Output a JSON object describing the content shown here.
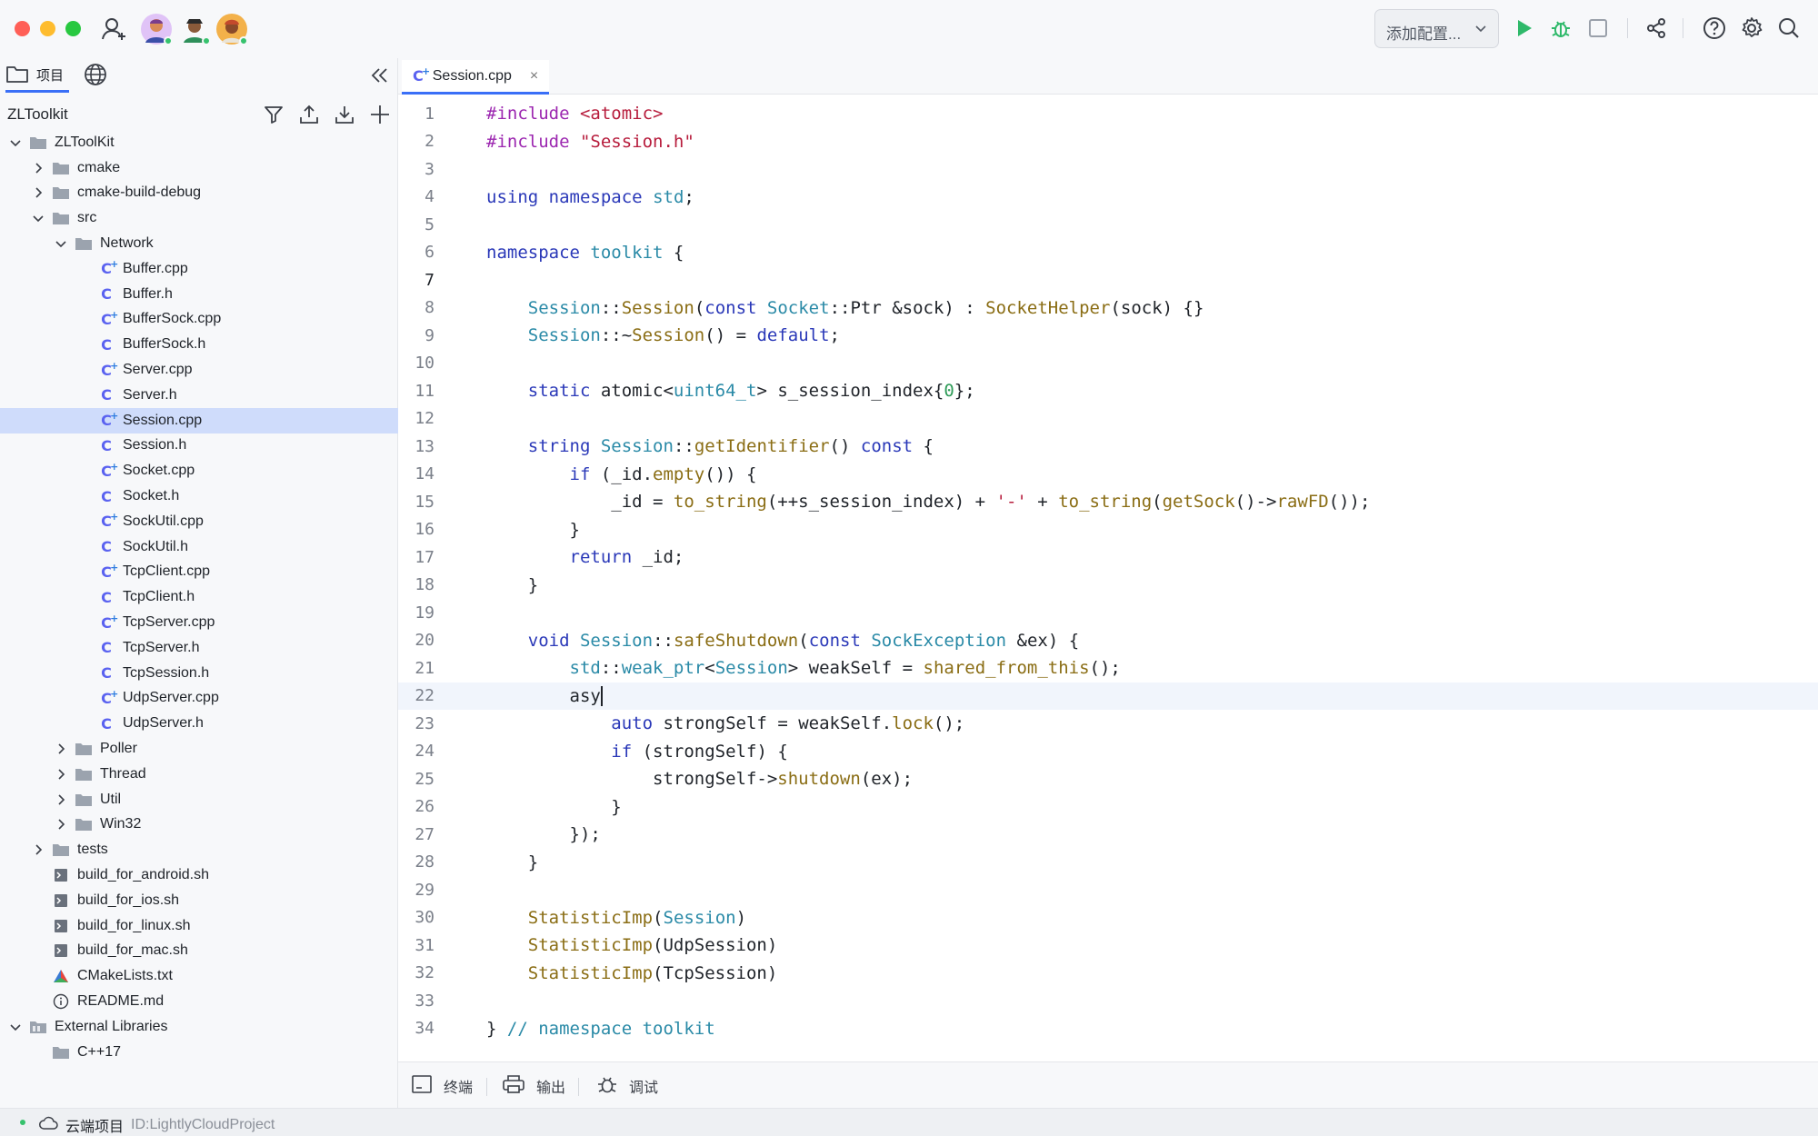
{
  "titlebar": {
    "config_label": "添加配置..."
  },
  "sidebar": {
    "tabs": [
      {
        "label": "项目",
        "icon": "folder-icon"
      },
      {
        "label": "",
        "icon": "globe-icon"
      }
    ],
    "project_name": "ZLToolkit",
    "tree": [
      {
        "label": "ZLToolKit",
        "depth": 0,
        "kind": "folder",
        "expanded": true
      },
      {
        "label": "cmake",
        "depth": 1,
        "kind": "folder",
        "expanded": false
      },
      {
        "label": "cmake-build-debug",
        "depth": 1,
        "kind": "folder",
        "expanded": false
      },
      {
        "label": "src",
        "depth": 1,
        "kind": "folder",
        "expanded": true
      },
      {
        "label": "Network",
        "depth": 2,
        "kind": "folder",
        "expanded": true
      },
      {
        "label": "Buffer.cpp",
        "depth": 3,
        "kind": "cpp"
      },
      {
        "label": "Buffer.h",
        "depth": 3,
        "kind": "h"
      },
      {
        "label": "BufferSock.cpp",
        "depth": 3,
        "kind": "cpp"
      },
      {
        "label": "BufferSock.h",
        "depth": 3,
        "kind": "h"
      },
      {
        "label": "Server.cpp",
        "depth": 3,
        "kind": "cpp"
      },
      {
        "label": "Server.h",
        "depth": 3,
        "kind": "h"
      },
      {
        "label": "Session.cpp",
        "depth": 3,
        "kind": "cpp",
        "selected": true
      },
      {
        "label": "Session.h",
        "depth": 3,
        "kind": "h"
      },
      {
        "label": "Socket.cpp",
        "depth": 3,
        "kind": "cpp"
      },
      {
        "label": "Socket.h",
        "depth": 3,
        "kind": "h"
      },
      {
        "label": "SockUtil.cpp",
        "depth": 3,
        "kind": "cpp"
      },
      {
        "label": "SockUtil.h",
        "depth": 3,
        "kind": "h"
      },
      {
        "label": "TcpClient.cpp",
        "depth": 3,
        "kind": "cpp"
      },
      {
        "label": "TcpClient.h",
        "depth": 3,
        "kind": "h"
      },
      {
        "label": "TcpServer.cpp",
        "depth": 3,
        "kind": "cpp"
      },
      {
        "label": "TcpServer.h",
        "depth": 3,
        "kind": "h"
      },
      {
        "label": "TcpSession.h",
        "depth": 3,
        "kind": "h"
      },
      {
        "label": "UdpServer.cpp",
        "depth": 3,
        "kind": "cpp"
      },
      {
        "label": "UdpServer.h",
        "depth": 3,
        "kind": "h"
      },
      {
        "label": "Poller",
        "depth": 2,
        "kind": "folder",
        "expanded": false
      },
      {
        "label": "Thread",
        "depth": 2,
        "kind": "folder",
        "expanded": false
      },
      {
        "label": "Util",
        "depth": 2,
        "kind": "folder",
        "expanded": false
      },
      {
        "label": "Win32",
        "depth": 2,
        "kind": "folder",
        "expanded": false
      },
      {
        "label": "tests",
        "depth": 1,
        "kind": "folder",
        "expanded": false
      },
      {
        "label": "build_for_android.sh",
        "depth": 1,
        "kind": "sh"
      },
      {
        "label": "build_for_ios.sh",
        "depth": 1,
        "kind": "sh"
      },
      {
        "label": "build_for_linux.sh",
        "depth": 1,
        "kind": "sh"
      },
      {
        "label": "build_for_mac.sh",
        "depth": 1,
        "kind": "sh"
      },
      {
        "label": "CMakeLists.txt",
        "depth": 1,
        "kind": "cmake"
      },
      {
        "label": "README.md",
        "depth": 1,
        "kind": "info"
      },
      {
        "label": "External Libraries",
        "depth": 0,
        "kind": "library",
        "expanded": true
      },
      {
        "label": "C++17",
        "depth": 1,
        "kind": "folder"
      }
    ]
  },
  "editor": {
    "tab_label": "Session.cpp",
    "current_line": 22,
    "lines": [
      {
        "n": "1",
        "text": "#include <atomic>"
      },
      {
        "n": "2",
        "text": "#include \"Session.h\""
      },
      {
        "n": "3",
        "text": ""
      },
      {
        "n": "4",
        "text": "using namespace std;"
      },
      {
        "n": "5",
        "text": ""
      },
      {
        "n": "6",
        "text": "namespace toolkit {"
      },
      {
        "n": "7",
        "text": ""
      },
      {
        "n": "8",
        "text": "    Session::Session(const Socket::Ptr &sock) : SocketHelper(sock) {}"
      },
      {
        "n": "9",
        "text": "    Session::~Session() = default;"
      },
      {
        "n": "10",
        "text": ""
      },
      {
        "n": "11",
        "text": "    static atomic<uint64_t> s_session_index{0};"
      },
      {
        "n": "12",
        "text": ""
      },
      {
        "n": "13",
        "text": "    string Session::getIdentifier() const {"
      },
      {
        "n": "14",
        "text": "        if (_id.empty()) {"
      },
      {
        "n": "15",
        "text": "            _id = to_string(++s_session_index) + '-' + to_string(getSock()->rawFD());"
      },
      {
        "n": "16",
        "text": "        }"
      },
      {
        "n": "17",
        "text": "        return _id;"
      },
      {
        "n": "18",
        "text": "    }"
      },
      {
        "n": "19",
        "text": ""
      },
      {
        "n": "20",
        "text": "    void Session::safeShutdown(const SockException &ex) {"
      },
      {
        "n": "21",
        "text": "        std::weak_ptr<Session> weakSelf = shared_from_this();"
      },
      {
        "n": "22",
        "text": "        asy"
      },
      {
        "n": "23",
        "text": "            auto strongSelf = weakSelf.lock();"
      },
      {
        "n": "24",
        "text": "            if (strongSelf) {"
      },
      {
        "n": "25",
        "text": "                strongSelf->shutdown(ex);"
      },
      {
        "n": "26",
        "text": "            }"
      },
      {
        "n": "27",
        "text": "        });"
      },
      {
        "n": "28",
        "text": "    }"
      },
      {
        "n": "29",
        "text": ""
      },
      {
        "n": "30",
        "text": "    StatisticImp(Session)"
      },
      {
        "n": "31",
        "text": "    StatisticImp(UdpSession)"
      },
      {
        "n": "32",
        "text": "    StatisticImp(TcpSession)"
      },
      {
        "n": "33",
        "text": ""
      },
      {
        "n": "34",
        "text": "} // namespace toolkit"
      }
    ]
  },
  "bottom_tabs": [
    {
      "label": "终端",
      "icon": "terminal-icon"
    },
    {
      "label": "输出",
      "icon": "printer-icon"
    },
    {
      "label": "调试",
      "icon": "bug-icon"
    }
  ],
  "status": {
    "project_label": "云端项目",
    "project_id": "ID:LightlyCloudProject"
  },
  "colors": {
    "accent": "#3a6ff7",
    "selection": "#cfdcfb",
    "run_green": "#2fb96a"
  }
}
